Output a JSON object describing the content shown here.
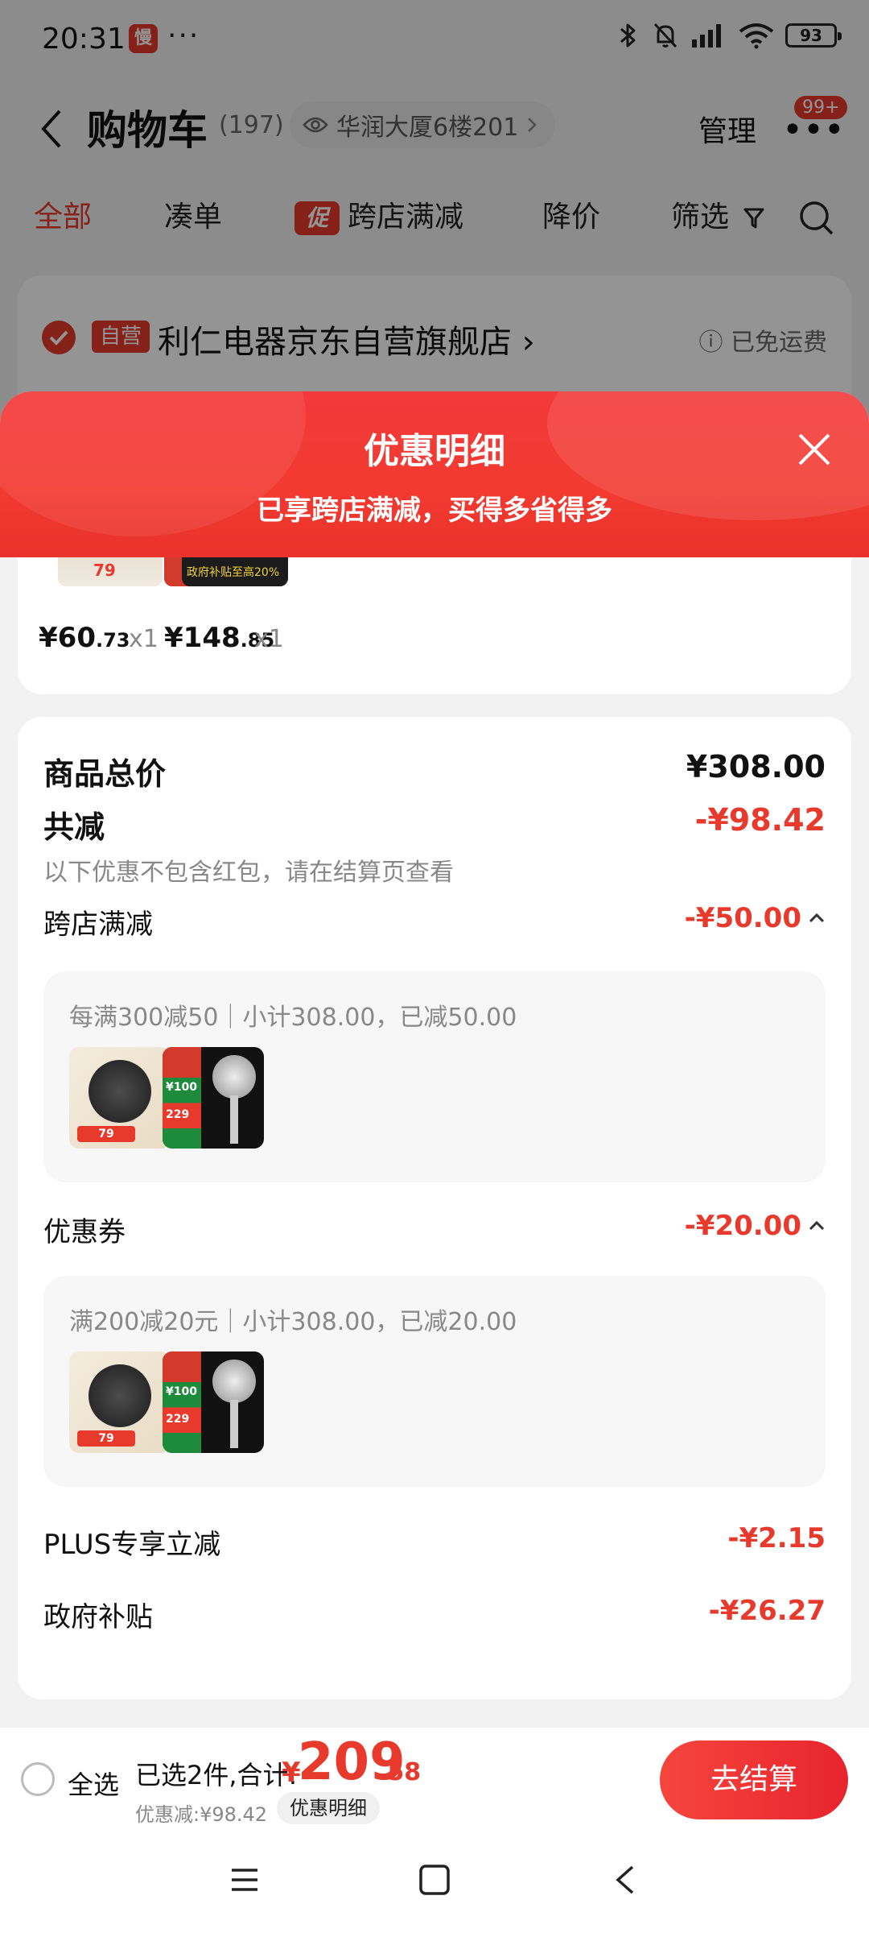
{
  "status_bar": {
    "time": "20:31",
    "app_icon_glyph": "慢",
    "dots": "···",
    "battery": "93"
  },
  "header": {
    "title": "购物车",
    "count": "(197)",
    "address": "华润大厦6楼201",
    "manage": "管理",
    "badge": "99+"
  },
  "tabs": [
    "全部",
    "凑单",
    "跨店满减",
    "降价",
    "筛选"
  ],
  "promo_tag": "促",
  "store": {
    "self_label": "自营",
    "name": "利仁电器京东自营旗舰店",
    "shipping": "已免运费"
  },
  "sheet": {
    "title": "优惠明细",
    "subtitle": "已享跨店满减，买得多省得多",
    "items": [
      {
        "price_int": "¥60",
        "price_dec": ".73",
        "qty": "x1",
        "thumb_label": "79"
      },
      {
        "price_int": "¥148",
        "price_dec": ".85",
        "qty": "x1",
        "thumb_label": "政府补贴至高20%"
      }
    ],
    "total_label": "商品总价",
    "total_value": "¥308.00",
    "discount_label": "共减",
    "discount_value": "-¥98.42",
    "discount_note": "以下优惠不包含红包，请在结算页查看",
    "sections": [
      {
        "label": "跨店满减",
        "value": "-¥50.00",
        "rule": "每满300减50｜小计308.00，已减50.00"
      },
      {
        "label": "优惠券",
        "value": "-¥20.00",
        "rule": "满200减20元｜小计308.00，已减20.00"
      }
    ],
    "plus_label": "PLUS专享立减",
    "plus_value": "-¥2.15",
    "gov_label": "政府补贴",
    "gov_value": "-¥26.27",
    "product_tags": {
      "pan_price": "79",
      "shower_price": "¥100",
      "shower_price2": "229"
    }
  },
  "bottom": {
    "select_all": "全选",
    "selected_text": "已选2件,合计:",
    "currency": "¥",
    "total_int": "209",
    "total_dec": ".58",
    "saved": "优惠减:¥98.42",
    "detail_button": "优惠明细",
    "checkout": "去结算"
  },
  "colors": {
    "accent": "#e73a2c",
    "sheet_header": "#f23a31"
  },
  "icons": [
    "bluetooth-icon",
    "mute-icon",
    "signal-icon",
    "wifi-icon",
    "battery-icon",
    "eye-icon",
    "filter-icon",
    "search-icon",
    "close-icon",
    "chevron-up-icon",
    "menu-icon",
    "home-icon",
    "back-icon"
  ]
}
